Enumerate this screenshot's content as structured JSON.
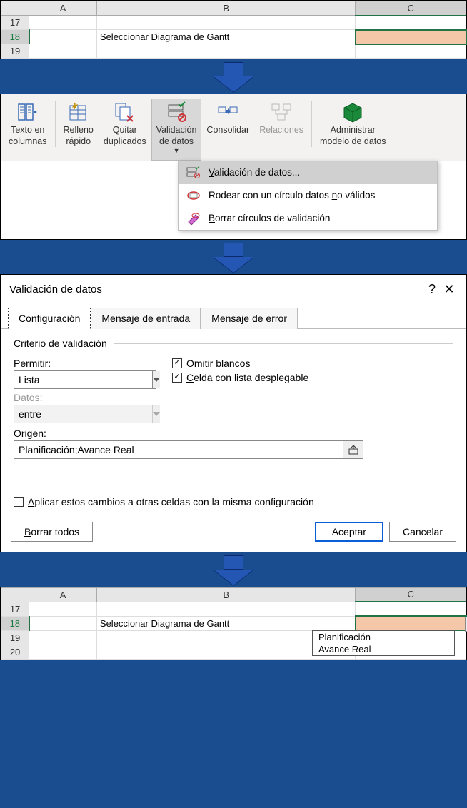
{
  "sheet_top": {
    "columns": [
      "A",
      "B",
      "C"
    ],
    "rows": [
      "17",
      "18",
      "19"
    ],
    "b18": "Seleccionar Diagrama de Gantt"
  },
  "ribbon": {
    "btn_textcols": "Texto en\ncolumnas",
    "btn_relleno": "Relleno\nrápido",
    "btn_quitar": "Quitar\nduplicados",
    "btn_validacion": "Validación\nde datos",
    "btn_consolidar": "Consolidar",
    "btn_relaciones": "Relaciones",
    "btn_admin": "Administrar\nmodelo de datos"
  },
  "submenu": {
    "item1": "Validación de datos...",
    "item2a": "Rodear con un círculo datos ",
    "item2b": "n",
    "item2c": "o válidos",
    "item3a": "B",
    "item3b": "orrar círculos de validación"
  },
  "dialog": {
    "title": "Validación de datos",
    "tabs": {
      "t1": "Configuración",
      "t2": "Mensaje de entrada",
      "t3": "Mensaje de error"
    },
    "group": "Criterio de validación",
    "permitir_lbl": "Permitir:",
    "permitir_val": "Lista",
    "datos_lbl": "Datos:",
    "datos_val": "entre",
    "chk1a": "Omitir blanco",
    "chk1b": "s",
    "chk2a": "C",
    "chk2b": "elda con lista desplegable",
    "origen_lbl": "Origen:",
    "origen_val": "Planificación;Avance Real",
    "apply_a": "A",
    "apply_b": "plicar estos cambios a otras celdas con la misma configuración",
    "borrar_a": "B",
    "borrar_b": "orrar todos",
    "aceptar": "Aceptar",
    "cancelar": "Cancelar"
  },
  "sheet_bottom": {
    "columns": [
      "A",
      "B",
      "C"
    ],
    "rows": [
      "17",
      "18",
      "19",
      "20"
    ],
    "b18": "Seleccionar Diagrama de Gantt",
    "dd1": "Planificación",
    "dd2": "Avance Real"
  }
}
